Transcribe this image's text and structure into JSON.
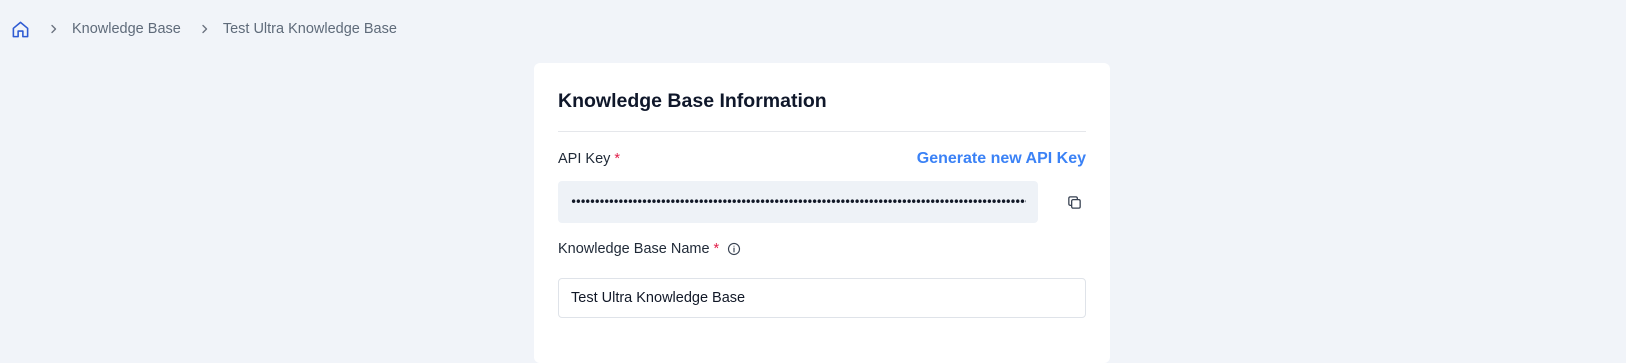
{
  "breadcrumb": {
    "home_icon": "home-icon",
    "separator_icon": "chevron-right-icon",
    "items": [
      "Knowledge Base",
      "Test Ultra Knowledge Base"
    ]
  },
  "card": {
    "title": "Knowledge Base Information",
    "api_key": {
      "label": "API Key",
      "required_mark": "*",
      "generate_label": "Generate new API Key",
      "value": "••••••••••••••••••••••••••••••••••••••••••••••••••••••••••••••••••••••••••••••••••••••••••••••••••••••••••••••••••••••••••••••••••••••••••••••••••••••",
      "copy_icon": "copy-icon"
    },
    "kb_name": {
      "label": "Knowledge Base Name",
      "required_mark": "*",
      "info_icon": "info-icon",
      "value": "Test Ultra Knowledge Base"
    }
  },
  "colors": {
    "page_bg": "#f1f4f9",
    "link_blue": "#3b82f6",
    "required_red": "#e11d48",
    "home_icon": "#2f5bd3"
  }
}
